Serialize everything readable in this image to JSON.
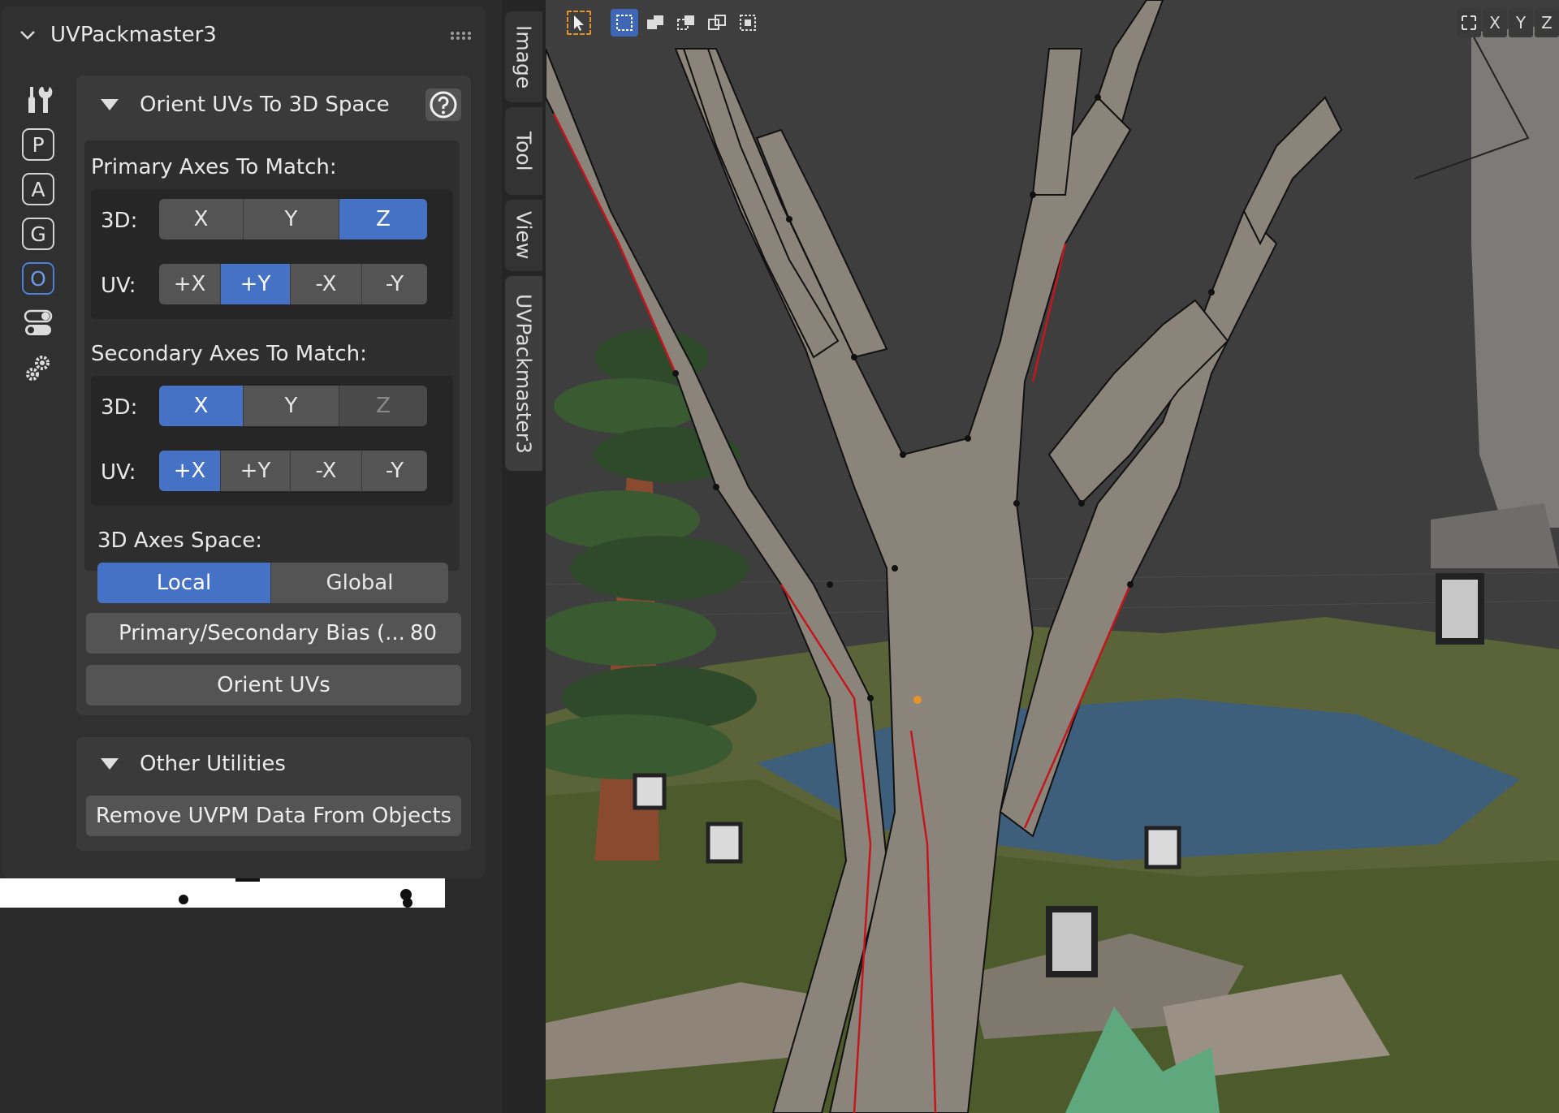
{
  "panel": {
    "title": "UVPackmaster3"
  },
  "side_icons": [
    {
      "name": "tools",
      "glyph": ""
    },
    {
      "name": "pack",
      "glyph": "P"
    },
    {
      "name": "align",
      "glyph": "A"
    },
    {
      "name": "groups",
      "glyph": "G"
    },
    {
      "name": "orient",
      "glyph": "O",
      "active": true
    },
    {
      "name": "toggles",
      "glyph": ""
    },
    {
      "name": "settings",
      "glyph": ""
    }
  ],
  "orient_section": {
    "title": "Orient UVs To 3D Space",
    "primary_label": "Primary Axes To Match:",
    "secondary_label": "Secondary Axes To Match:",
    "row_3d_label": "3D:",
    "row_uv_label": "UV:",
    "primary_3d": [
      {
        "label": "X"
      },
      {
        "label": "Y"
      },
      {
        "label": "Z",
        "selected": true
      }
    ],
    "primary_uv": [
      {
        "label": "+X"
      },
      {
        "label": "+Y",
        "selected": true
      },
      {
        "label": "-X"
      },
      {
        "label": "-Y"
      }
    ],
    "secondary_3d": [
      {
        "label": "X",
        "selected": true
      },
      {
        "label": "Y"
      },
      {
        "label": "Z",
        "disabled": true
      }
    ],
    "secondary_uv": [
      {
        "label": "+X",
        "selected": true
      },
      {
        "label": "+Y"
      },
      {
        "label": "-X"
      },
      {
        "label": "-Y"
      }
    ],
    "axes_space_label": "3D Axes Space:",
    "axes_space": [
      {
        "label": "Local",
        "selected": true
      },
      {
        "label": "Global"
      }
    ],
    "bias_label": "Primary/Secondary Bias (...",
    "bias_value": "80",
    "orient_button": "Orient UVs"
  },
  "other_section": {
    "title": "Other Utilities",
    "remove_button": "Remove UVPM Data From Objects"
  },
  "tabs": [
    "Image",
    "Tool",
    "View",
    "UVPackmaster3"
  ],
  "viewport": {
    "axis_buttons": [
      "X",
      "Y",
      "Z"
    ]
  },
  "colors": {
    "accent": "#4572c4",
    "button": "#545454",
    "panel": "#303030"
  }
}
